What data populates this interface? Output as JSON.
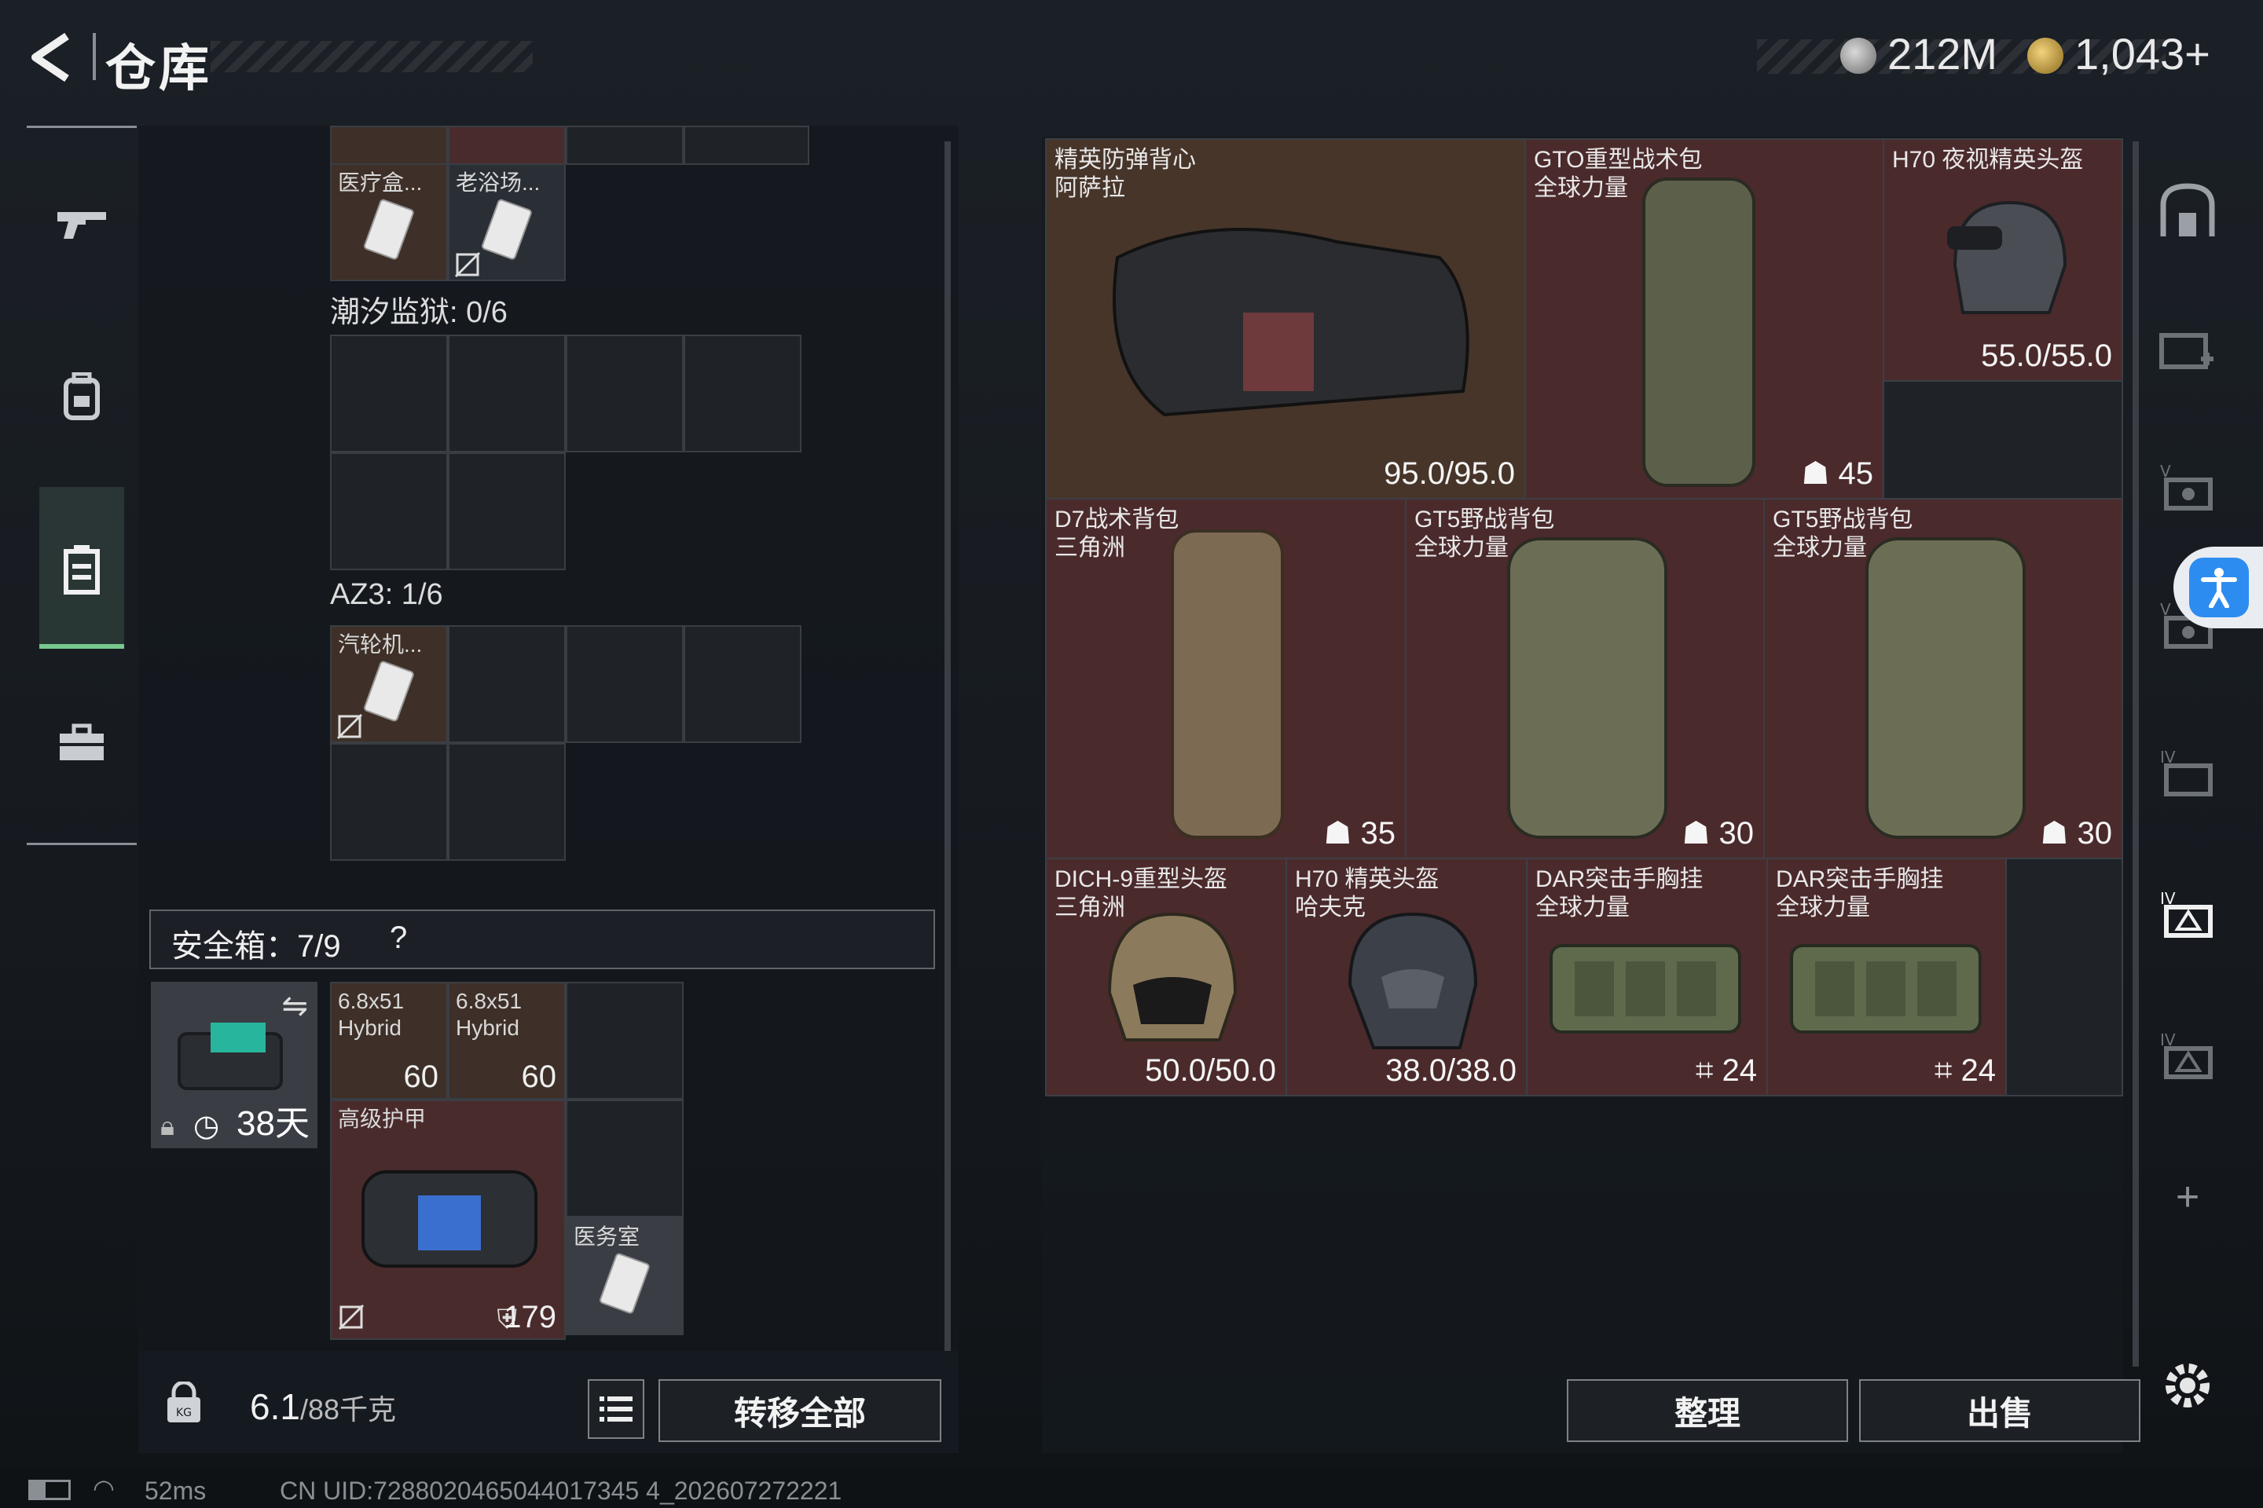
{
  "header": {
    "title": "仓库",
    "currency_1": "212M",
    "currency_2": "1,043+"
  },
  "left_rail": {
    "icons": [
      "gun-icon",
      "backpack-icon",
      "container-icon",
      "toolbox-icon"
    ]
  },
  "left_panel": {
    "top_items": [
      {
        "label": "医疗盒..."
      },
      {
        "label": "老浴场..."
      }
    ],
    "section_1": "潮汐监狱: 0/6",
    "section_2": "AZ3: 1/6",
    "section_2_item": "汽轮机...",
    "safebox": {
      "title": "安全箱：7/9",
      "help": "?",
      "days": "38天"
    },
    "safe_items": [
      {
        "label": "6.8x51\nHybrid",
        "count": "60"
      },
      {
        "label": "6.8x51\nHybrid",
        "count": "60"
      },
      {
        "label": "高级护甲",
        "count": "179"
      },
      {
        "label": "医务室"
      }
    ],
    "weight": "6.1",
    "weight_max": "/88千克",
    "transfer_all": "转移全部"
  },
  "right_panel": {
    "items": [
      {
        "name": "精英防弹背心",
        "sub": "阿萨拉",
        "value": "95.0/95.0"
      },
      {
        "name": "GTO重型战术包",
        "sub": "全球力量",
        "value": "45"
      },
      {
        "name": "H70 夜视精英头盔",
        "sub": "",
        "value": "55.0/55.0"
      },
      {
        "name": "D7战术背包",
        "sub": "三角洲",
        "value": "35"
      },
      {
        "name": "GT5野战背包",
        "sub": "全球力量",
        "value": "30"
      },
      {
        "name": "GT5野战背包",
        "sub": "全球力量",
        "value": "30"
      },
      {
        "name": "DICH-9重型头盔",
        "sub": "三角洲",
        "value": "50.0/50.0"
      },
      {
        "name": "H70 精英头盔",
        "sub": "哈夫克",
        "value": "38.0/38.0"
      },
      {
        "name": "DAR突击手胸挂",
        "sub": "全球力量",
        "value": "24"
      },
      {
        "name": "DAR突击手胸挂",
        "sub": "全球力量",
        "value": "24"
      }
    ],
    "organize": "整理",
    "sell": "出售"
  },
  "status": {
    "ping": "52ms",
    "uid": "CN UID:7288020465044017345 4_202607272221"
  },
  "colors": {
    "red_cell": "#4b2a2c",
    "brown_cell": "#47352a",
    "accent_green": "#77c88e",
    "accessibility_blue": "#2d8cf0"
  }
}
